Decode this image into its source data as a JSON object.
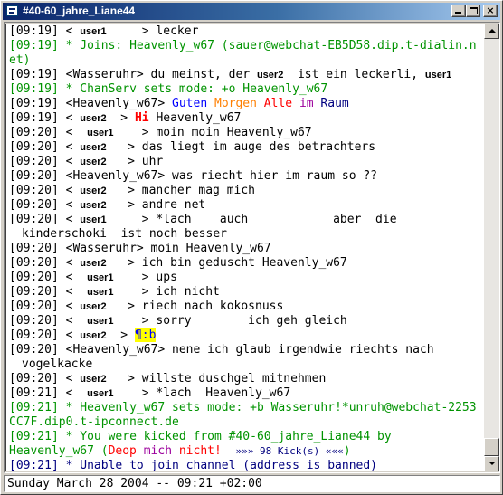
{
  "window": {
    "title": "#40-60_jahre_Liane44",
    "buttons": {
      "minimize": "_",
      "maximize": "□",
      "close": "×"
    }
  },
  "log": [
    {
      "time": "[09:19]",
      "text": "< ",
      "nick": "user1",
      "rest": "> lecker"
    },
    {
      "time": "[09:19]",
      "text": "* Joins: Heavenly_w67 (sauer@webchat-EB5D58.dip.t-dialin.net)"
    },
    {
      "time": "[09:19]",
      "text": "<Wasseruhr> du meinst, der ",
      "nick": "user2",
      "rest": "ist ein leckerli,",
      "nick2": "user1"
    },
    {
      "time": "[09:19]",
      "text": "* ChanServ sets mode: +o Heavenly_w67"
    },
    {
      "time": "[09:19]",
      "text": "<Heavenly_w67>",
      "words": [
        "Guten",
        "Morgen",
        "Alle",
        "im",
        "Raum"
      ]
    },
    {
      "time": "[09:19]",
      "text": "< ",
      "nick": "user2",
      "hi": "Hi",
      "rest": "Heavenly_w67"
    },
    {
      "time": "[09:20]",
      "text": "< ",
      "nick": "user1",
      "rest": "> moin moin Heavenly_w67"
    },
    {
      "time": "[09:20]",
      "text": "< ",
      "nick": "user2",
      "rest": "> das liegt im auge des betrachters"
    },
    {
      "time": "[09:20]",
      "text": "< ",
      "nick": "user2",
      "rest": "> uhr"
    },
    {
      "time": "[09:20]",
      "text": "<Heavenly_w67> was riecht hier im raum so ??"
    },
    {
      "time": "[09:20]",
      "text": "< ",
      "nick": "user2",
      "rest": "> mancher mag mich"
    },
    {
      "time": "[09:20]",
      "text": "< ",
      "nick": "user2",
      "rest": "> andre net"
    },
    {
      "time": "[09:20]",
      "text": "< ",
      "nick": "user1",
      "rest": "> *lach    auch            aber  die",
      "cont": "kinderschoki  ist noch besser"
    },
    {
      "time": "[09:20]",
      "text": "<Wasseruhr> moin Heavenly_w67"
    },
    {
      "time": "[09:20]",
      "text": "< ",
      "nick": "user2",
      "rest": "> ich bin geduscht Heavenly_w67"
    },
    {
      "time": "[09:20]",
      "text": "< ",
      "nick": "user1",
      "rest": "> ups"
    },
    {
      "time": "[09:20]",
      "text": "< ",
      "nick": "user1",
      "rest": "> ich nicht"
    },
    {
      "time": "[09:20]",
      "text": "< ",
      "nick": "user2",
      "rest": "> riech nach kokosnuss"
    },
    {
      "time": "[09:20]",
      "text": "< ",
      "nick": "user1",
      "rest": "> sorry        ich geh gleich"
    },
    {
      "time": "[09:20]",
      "text": "< ",
      "nick": "user2",
      "rest": "> ",
      "smiley": "¶:b"
    },
    {
      "time": "[09:20]",
      "text": "<Heavenly_w67> nene ich glaub irgendwie riechts nach",
      "cont": "vogelkacke"
    },
    {
      "time": "[09:20]",
      "text": "< ",
      "nick": "user2",
      "rest": "> willste duschgel mitnehmen"
    },
    {
      "time": "[09:21]",
      "text": "< ",
      "nick": "user1",
      "rest": "> *lach  Heavenly_w67"
    },
    {
      "time": "[09:21]",
      "text": "* Heavenly_w67 sets mode: +b Wasseruhr!*unruh@webchat-2253CC7F.dip0.t-ipconnect.de"
    },
    {
      "time": "[09:21]",
      "text": "* You were kicked from #40-60_jahre_Liane44 by",
      "cont_pre": "Heavenly_w67 (",
      "cont_words": [
        "Deop",
        "mich",
        "nicht!"
      ],
      "cont_kick": "»»» 98 Kick(s) «««",
      "cont_end": ")"
    },
    {
      "time": "[09:21]",
      "text": "* Unable to join channel (address is banned)"
    }
  ],
  "status": {
    "text": "Sunday March 28 2004 -- 09:21 +02:00"
  }
}
